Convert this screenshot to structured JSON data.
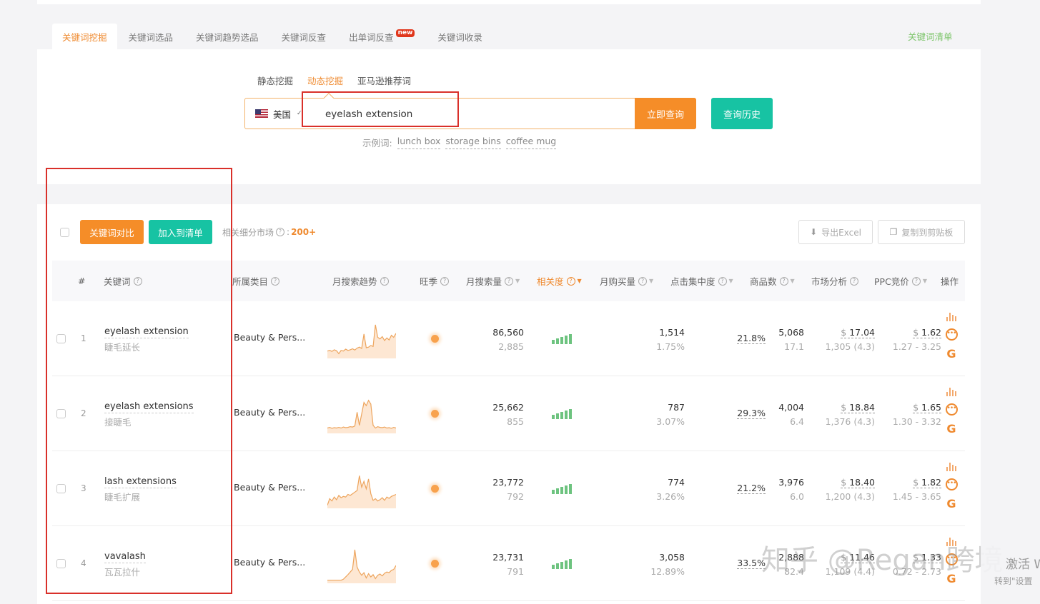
{
  "tabs": [
    {
      "label": "关键词挖掘",
      "active": true
    },
    {
      "label": "关键词选品",
      "active": false
    },
    {
      "label": "关键词趋势选品",
      "active": false
    },
    {
      "label": "关键词反查",
      "active": false
    },
    {
      "label": "出单词反查",
      "active": false,
      "badge": "new"
    },
    {
      "label": "关键词收录",
      "active": false
    }
  ],
  "keyword_list_link": "关键词清单",
  "search": {
    "modes": [
      {
        "label": "静态挖掘",
        "active": false
      },
      {
        "label": "动态挖掘",
        "active": true
      },
      {
        "label": "亚马逊推荐词",
        "active": false
      }
    ],
    "country": "美国",
    "country_icon": "us-flag-icon",
    "query": "eyelash extension",
    "search_button": "立即查询",
    "history_button": "查询历史",
    "examples_label": "示例词:",
    "examples": [
      "lunch box",
      "storage bins",
      "coffee mug"
    ]
  },
  "toolbar": {
    "compare_button": "关键词对比",
    "add_button": "加入到清单",
    "niche_label": "相关细分市场",
    "niche_value": "200+",
    "export_button": "导出Excel",
    "copy_button": "复制到剪贴板"
  },
  "table": {
    "headers": {
      "index": "#",
      "keyword": "关键词",
      "category": "所属类目",
      "trend": "月搜索趋势",
      "season": "旺季",
      "search_volume": "月搜索量",
      "relevance": "相关度",
      "purchases": "月购买量",
      "click_concentration": "点击集中度",
      "products": "商品数",
      "market": "市场分析",
      "ppc": "PPC竞价",
      "actions": "操作"
    },
    "active_sort": "relevance",
    "rows": [
      {
        "index": "1",
        "keyword": "eyelash extension",
        "keyword_cn": "睫毛延长",
        "category": "Beauty & Pers...",
        "trend": [
          0.18,
          0.2,
          0.17,
          0.22,
          0.19,
          0.1,
          0.2,
          0.18,
          0.24,
          0.2,
          0.22,
          0.25,
          0.21,
          0.27,
          0.3,
          0.26,
          0.7,
          0.28,
          0.3,
          0.35,
          0.32,
          0.98,
          0.6,
          0.55,
          0.62,
          0.5,
          0.58,
          0.52,
          0.66,
          0.6,
          0.72
        ],
        "season": true,
        "search_volume": "86,560",
        "search_volume_daily": "2,885",
        "relevance_level": 5,
        "purchases": "1,514",
        "purchase_rate": "1.75%",
        "click_concentration": "21.8%",
        "products": "5,068",
        "supply_demand": "17.1",
        "price": "17.04",
        "reviews": "1,305 (4.3)",
        "ppc": "1.62",
        "ppc_range": "1.27 - 3.25"
      },
      {
        "index": "2",
        "keyword": "eyelash extensions",
        "keyword_cn": "接睫毛",
        "category": "Beauty & Pers...",
        "trend": [
          0.12,
          0.14,
          0.11,
          0.13,
          0.12,
          0.14,
          0.12,
          0.15,
          0.13,
          0.14,
          0.16,
          0.15,
          0.18,
          0.6,
          0.2,
          0.55,
          0.9,
          0.8,
          0.96,
          0.85,
          0.2,
          0.12,
          0.16,
          0.14,
          0.13,
          0.15,
          0.12,
          0.13,
          0.11,
          0.14,
          0.12
        ],
        "season": true,
        "search_volume": "25,662",
        "search_volume_daily": "855",
        "relevance_level": 5,
        "purchases": "787",
        "purchase_rate": "3.07%",
        "click_concentration": "29.3%",
        "products": "4,004",
        "supply_demand": "6.4",
        "price": "18.84",
        "reviews": "1,376 (4.3)",
        "ppc": "1.65",
        "ppc_range": "1.30 - 3.32"
      },
      {
        "index": "3",
        "keyword": "lash extensions",
        "keyword_cn": "睫毛扩展",
        "category": "Beauty & Pers...",
        "trend": [
          0.05,
          0.25,
          0.18,
          0.3,
          0.22,
          0.35,
          0.28,
          0.32,
          0.3,
          0.38,
          0.35,
          0.4,
          0.45,
          0.5,
          0.95,
          0.6,
          0.78,
          0.55,
          0.85,
          0.4,
          0.2,
          0.25,
          0.18,
          0.22,
          0.28,
          0.2,
          0.3,
          0.26,
          0.32,
          0.35,
          0.38
        ],
        "season": true,
        "search_volume": "23,772",
        "search_volume_daily": "792",
        "relevance_level": 5,
        "purchases": "774",
        "purchase_rate": "3.26%",
        "click_concentration": "21.2%",
        "products": "3,976",
        "supply_demand": "6.0",
        "price": "18.40",
        "reviews": "1,200 (4.3)",
        "ppc": "1.82",
        "ppc_range": "1.45 - 3.65"
      },
      {
        "index": "4",
        "keyword": "vavalash",
        "keyword_cn": "瓦瓦拉什",
        "category": "Beauty & Pers...",
        "trend": [
          0.05,
          0.05,
          0.05,
          0.05,
          0.05,
          0.05,
          0.05,
          0.08,
          0.15,
          0.22,
          0.3,
          0.38,
          0.98,
          0.45,
          0.3,
          0.2,
          0.28,
          0.12,
          0.25,
          0.15,
          0.22,
          0.1,
          0.2,
          0.24,
          0.18,
          0.26,
          0.3,
          0.28,
          0.35,
          0.38,
          0.5
        ],
        "season": true,
        "search_volume": "23,731",
        "search_volume_daily": "791",
        "relevance_level": 5,
        "purchases": "3,058",
        "purchase_rate": "12.89%",
        "click_concentration": "33.5%",
        "products": "2,888",
        "supply_demand": "82.4",
        "price": "11.46",
        "reviews": "1,109 (4.4)",
        "ppc": "1.33",
        "ppc_range": "0.72 - 2.73"
      }
    ],
    "currency": "$"
  },
  "colors": {
    "accent_orange": "#f58d28",
    "accent_teal": "#17c3a3",
    "relevance_green": "#6dc37f",
    "highlight_red": "#d9302a"
  },
  "overlay": {
    "watermark": "知乎 @Regan跨境",
    "activate_line1": "激活 W",
    "activate_line2": "转到\"设置"
  }
}
